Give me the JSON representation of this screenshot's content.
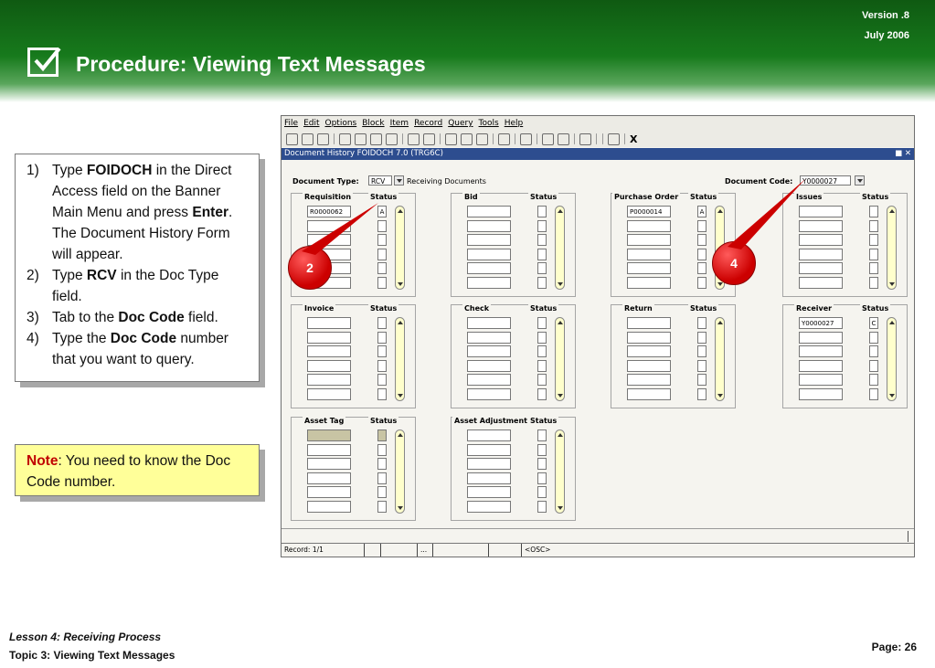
{
  "header": {
    "title": "Procedure: Viewing Text Messages",
    "version": "Version .8",
    "date": "July  2006"
  },
  "steps": [
    {
      "num": "1)",
      "parts": [
        "Type ",
        "FOIDOCH",
        " in the Direct Access field on the Banner Main Menu and press ",
        "Enter",
        ". The Document History Form will appear."
      ]
    },
    {
      "num": "2)",
      "parts": [
        "Type ",
        "RCV",
        " in the Doc Type field."
      ]
    },
    {
      "num": "3)",
      "parts": [
        "Tab to the ",
        "Doc Code",
        " field."
      ]
    },
    {
      "num": "4)",
      "parts": [
        "Type the ",
        "Doc Code",
        " number that you want to query."
      ]
    }
  ],
  "note": {
    "label": "Note",
    "text": ": You need to know the Doc Code number."
  },
  "window": {
    "menu": [
      "File",
      "Edit",
      "Options",
      "Block",
      "Item",
      "Record",
      "Query",
      "Tools",
      "Help"
    ],
    "form_title": "Document History  FOIDOCH  7.0  (TRG6C)",
    "doc_type_label": "Document Type:",
    "doc_type_value": "RCV",
    "doc_type_desc": "Receiving Documents",
    "doc_code_label": "Document Code:",
    "doc_code_value": "Y0000027",
    "status_label": "Status",
    "groups": [
      {
        "title": "Requisition",
        "first": "R0000062",
        "status": "A"
      },
      {
        "title": "Bid",
        "first": "",
        "status": ""
      },
      {
        "title": "Purchase Order",
        "first": "P0000014",
        "status": "A"
      },
      {
        "title": "Issues",
        "first": "",
        "status": ""
      },
      {
        "title": "Invoice",
        "first": "",
        "status": ""
      },
      {
        "title": "Check",
        "first": "",
        "status": ""
      },
      {
        "title": "Return",
        "first": "",
        "status": ""
      },
      {
        "title": "Receiver",
        "first": "Y0000027",
        "status": "C"
      },
      {
        "title": "Asset Tag",
        "first": "",
        "status": ""
      },
      {
        "title": "Asset Adjustment",
        "first": "",
        "status": ""
      }
    ],
    "record": "Record: 1/1",
    "dots": "...",
    "osc": "<OSC>"
  },
  "callouts": [
    "2",
    "4"
  ],
  "footer": {
    "lesson": "Lesson 4: Receiving Process",
    "topic": "Topic 3: Viewing Text Messages",
    "page": "Page: 26"
  }
}
